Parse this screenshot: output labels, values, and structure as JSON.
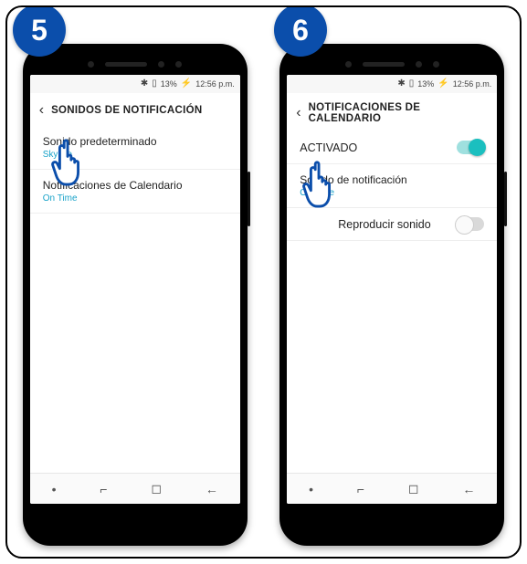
{
  "steps": {
    "five": "5",
    "six": "6"
  },
  "status": {
    "bt_icon": "✱",
    "batt_icon": "▯",
    "batt_pct": "13%",
    "batt_charge": "⚡",
    "time": "12:56 p.m."
  },
  "phone1": {
    "header_title": "SONIDOS DE NOTIFICACIÓN",
    "item1": {
      "title": "Sonido predeterminado",
      "sub": "Skyline"
    },
    "item2": {
      "title": "Notificaciones de Calendario",
      "sub": "On Time"
    }
  },
  "phone2": {
    "header_title": "NOTIFICACIONES DE CALENDARIO",
    "row_activated": "ACTIVADO",
    "item1": {
      "title": "Sonido de notificación",
      "sub": "On Time"
    },
    "item2": {
      "title": "Reproducir sonido"
    }
  },
  "nav": {
    "dot": "•",
    "recent": "⌐",
    "home": "◻",
    "back": "←"
  }
}
